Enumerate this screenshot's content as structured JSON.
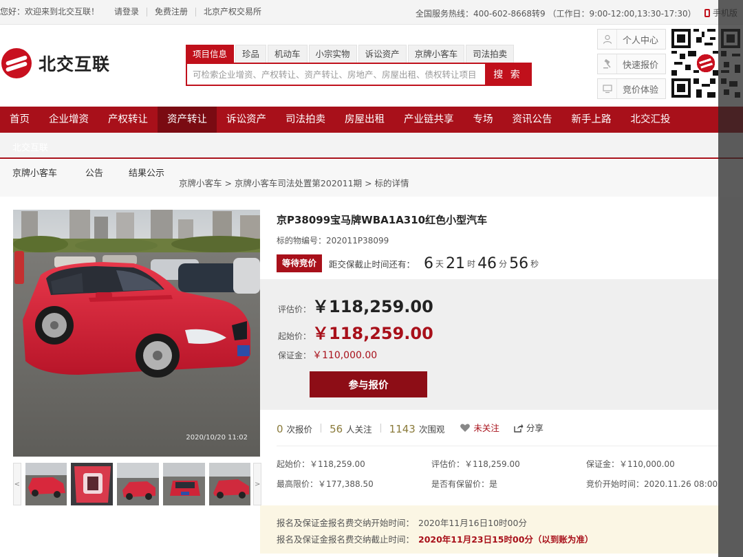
{
  "topbar": {
    "greeting": "您好：欢迎来到北交互联！",
    "login": "请登录",
    "register": "免费注册",
    "exchange": "北京产权交易所",
    "hotline": "全国服务热线：400-602-8668转9 （工作日：9:00-12:00,13:30-17:30）",
    "mobile": "手机版"
  },
  "header": {
    "logo_text": "北交互联",
    "search_tabs": [
      "项目信息",
      "珍品",
      "机动车",
      "小宗实物",
      "诉讼资产",
      "京牌小客车",
      "司法拍卖"
    ],
    "search_placeholder": "可检索企业增资、产权转让、资产转让、房地产、房屋出租、债权转让项目",
    "search_button": "搜 索",
    "side_buttons": [
      "个人中心",
      "快速报价",
      "竞价体验"
    ]
  },
  "mainnav": [
    "首页",
    "企业增资",
    "产权转让",
    "资产转让",
    "诉讼资产",
    "司法拍卖",
    "房屋出租",
    "产业链共享",
    "专场",
    "资讯公告",
    "新手上路",
    "北交汇投"
  ],
  "subbar_ghost": "北交互联",
  "subnav": [
    "京牌小客车",
    "公告",
    "结果公示"
  ],
  "breadcrumb": "京牌小客车 > 京牌小客车司法处置第202011期 > 标的详情",
  "photo_timestamp": "2020/10/20 11:02",
  "thumb_prev": "<",
  "thumb_next": ">",
  "item": {
    "title": "京P38099宝马牌WBA1A310红色小型汽车",
    "lot_label": "标的物编号：",
    "lot_no": "202011P38099",
    "status": "等待竞价",
    "countdown_label": "距交保截止时间还有：",
    "cd_days": "6",
    "cd_days_unit": "天",
    "cd_hours": "21",
    "cd_hours_unit": "时",
    "cd_minutes": "46",
    "cd_minutes_unit": "分",
    "cd_seconds": "56",
    "cd_seconds_unit": "秒"
  },
  "prices": {
    "appraisal_label": "评估价：",
    "appraisal_value": "￥118,259.00",
    "start_label": "起始价：",
    "start_value": "￥118,259.00",
    "deposit_label": "保证金：",
    "deposit_value": "￥110,000.00",
    "bid_button": "参与报价"
  },
  "stats": {
    "bids_num": "0",
    "bids_label": "次报价",
    "follows_num": "56",
    "follows_label": "人关注",
    "views_num": "1143",
    "views_label": "次围观",
    "follow_action": "未关注",
    "share_action": "分享"
  },
  "info": {
    "start": "起始价：￥118,259.00",
    "appraisal": "评估价：￥118,259.00",
    "deposit": "保证金：￥110,000.00",
    "max_price": "最高限价：￥177,388.50",
    "reserve": "是否有保留价：是",
    "bid_start": "竞价开始时间：2020.11.26 08:00"
  },
  "notice": {
    "start_label": "报名及保证金报名费交纳开始时间：",
    "start_value": "2020年11月16日10时00分",
    "end_label": "报名及保证金报名费交纳截止时间：",
    "end_value": "2020年11月23日15时00分（以到账为准）"
  },
  "colors": {
    "brand_red": "#a8101a",
    "dark_red": "#7a0b12"
  }
}
